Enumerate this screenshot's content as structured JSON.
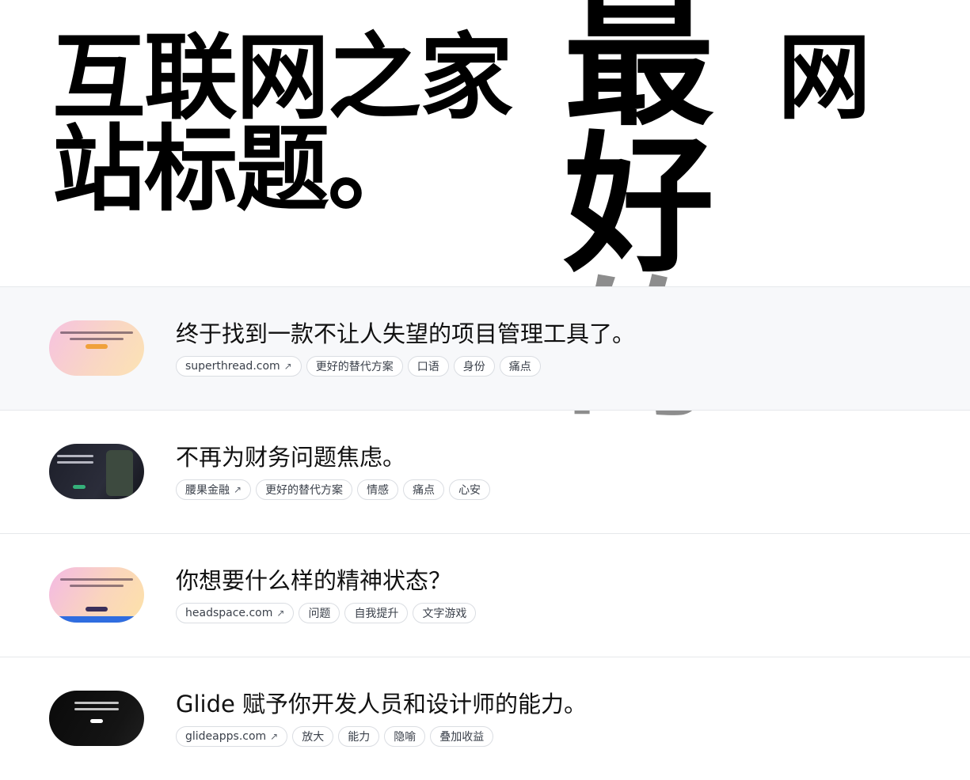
{
  "hero": {
    "title": "互联网之家站标题。",
    "big_chars": [
      "最",
      "好",
      "的"
    ],
    "side_char": "网"
  },
  "items": [
    {
      "title": "终于找到一款不让人失望的项目管理工具了。",
      "link": "superthread.com",
      "tags": [
        "更好的替代方案",
        "口语",
        "身份",
        "痛点"
      ]
    },
    {
      "title": "不再为财务问题焦虑。",
      "link": "腰果金融",
      "tags": [
        "更好的替代方案",
        "情感",
        "痛点",
        "心安"
      ]
    },
    {
      "title": "你想要什么样的精神状态？",
      "link": "headspace.com",
      "tags": [
        "问题",
        "自我提升",
        "文字游戏"
      ]
    },
    {
      "title": "Glide 赋予你开发人员和设计师的能力。",
      "link": "glideapps.com",
      "tags": [
        "放大",
        "能力",
        "隐喻",
        "叠加收益"
      ]
    }
  ],
  "icons": {
    "external_link": "arrow-up-right-icon"
  },
  "colors": {
    "highlight_row": "#f7f8fa",
    "border": "#e6e8eb",
    "text": "#111111",
    "faded_char": "#8d8d8d"
  }
}
